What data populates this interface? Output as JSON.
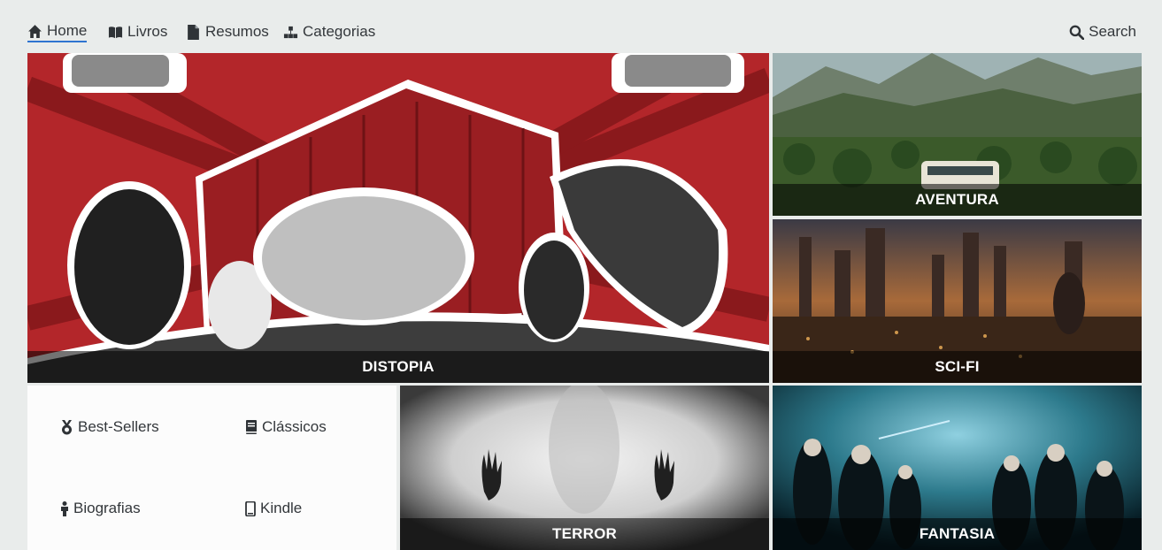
{
  "nav": {
    "home": "Home",
    "livros": "Livros",
    "resumos": "Resumos",
    "categorias": "Categorias",
    "search": "Search"
  },
  "tiles": {
    "distopia": "DISTOPIA",
    "aventura": "AVENTURA",
    "scifi": "SCI-FI",
    "terror": "TERROR",
    "fantasia": "FANTASIA"
  },
  "links": {
    "best_sellers": "Best-Sellers",
    "classicos": "Clássicos",
    "biografias": "Biografias",
    "kindle": "Kindle"
  },
  "colors": {
    "accent": "#2f74d0",
    "text": "#33373b",
    "background": "#e9eceb"
  }
}
